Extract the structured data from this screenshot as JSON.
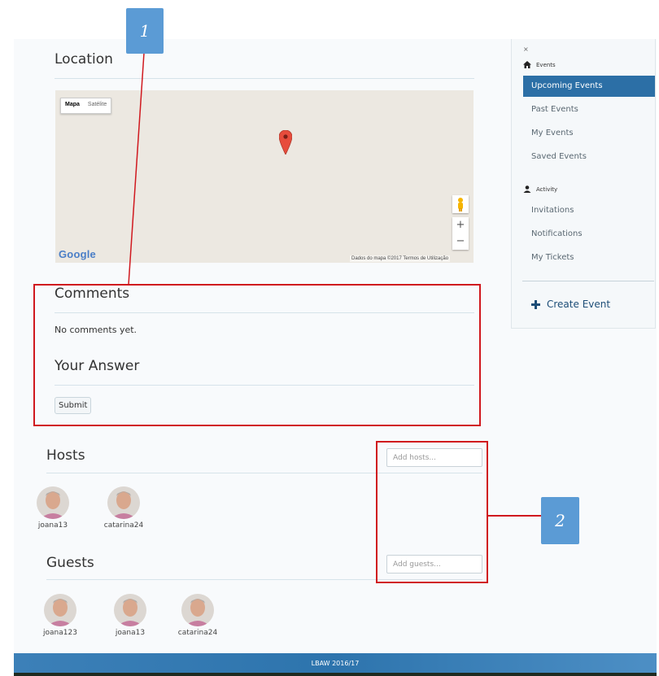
{
  "location": {
    "title": "Location"
  },
  "map": {
    "type_map": "Mapa",
    "type_satellite": "Satélite",
    "zoom_in": "+",
    "zoom_out": "−",
    "logo": "Google",
    "attribution": "Dados do mapa ©2017   Termos de Utilização"
  },
  "comments": {
    "title": "Comments",
    "empty": "No comments yet.",
    "answer_title": "Your Answer",
    "submit_label": "Submit"
  },
  "hosts": {
    "title": "Hosts",
    "add_placeholder": "Add hosts...",
    "users": [
      "joana13",
      "catarina24"
    ]
  },
  "guests": {
    "title": "Guests",
    "add_placeholder": "Add guests...",
    "users": [
      "joana123",
      "joana13",
      "catarina24"
    ]
  },
  "sidebar": {
    "close": "×",
    "events_header": "Events",
    "events_items": [
      "Upcoming Events",
      "Past Events",
      "My Events",
      "Saved Events"
    ],
    "activity_header": "Activity",
    "activity_items": [
      "Invitations",
      "Notifications",
      "My Tickets"
    ],
    "create_label": "Create Event",
    "active_item": "Upcoming Events"
  },
  "annotations": {
    "callout_1": "1",
    "callout_2": "2"
  },
  "footer": {
    "text": "LBAW 2016/17"
  },
  "colors": {
    "accent": "#2c6fa6",
    "annotation_red": "#d0181e",
    "callout_blue": "#5b9bd5"
  }
}
